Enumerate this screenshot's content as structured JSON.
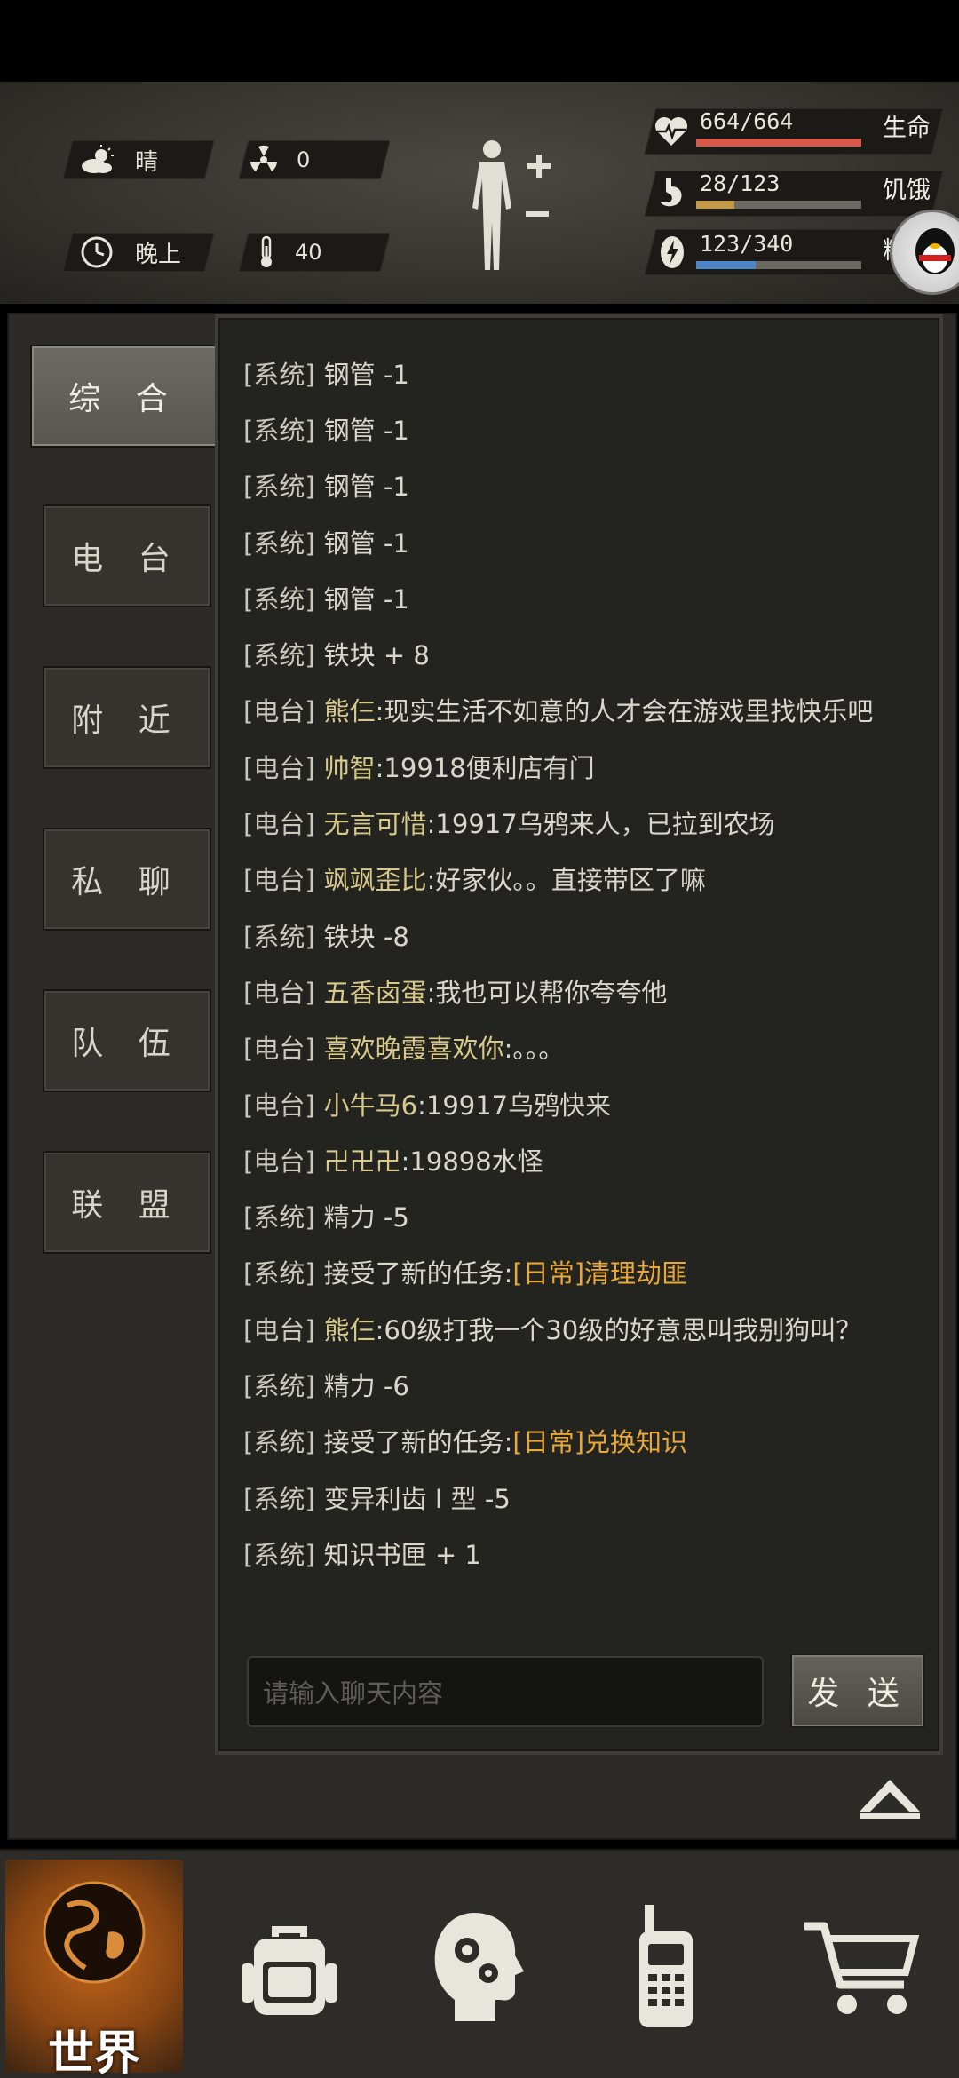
{
  "header": {
    "weather": "晴",
    "radiation": "0",
    "time_of_day": "晚上",
    "temperature": "40",
    "stats": [
      {
        "value": "664/664",
        "label": "生命",
        "fill": 1.0,
        "color": "#d65a4a"
      },
      {
        "value": "28/123",
        "label": "饥饿",
        "fill": 0.23,
        "color": "#c29a48"
      },
      {
        "value": "123/340",
        "label": "精力",
        "fill": 0.36,
        "color": "#4f86c6"
      }
    ]
  },
  "tabs": [
    "综 合",
    "电 台",
    "附 近",
    "私 聊",
    "队 伍",
    "联 盟"
  ],
  "chat": {
    "lines": [
      {
        "channel": "[系统]",
        "parts": [
          {
            "t": "钢管 -1",
            "c": "msg"
          }
        ]
      },
      {
        "channel": "[系统]",
        "parts": [
          {
            "t": "钢管 -1",
            "c": "msg"
          }
        ]
      },
      {
        "channel": "[系统]",
        "parts": [
          {
            "t": "钢管 -1",
            "c": "msg"
          }
        ]
      },
      {
        "channel": "[系统]",
        "parts": [
          {
            "t": "钢管 -1",
            "c": "msg"
          }
        ]
      },
      {
        "channel": "[系统]",
        "parts": [
          {
            "t": "钢管 -1",
            "c": "msg"
          }
        ]
      },
      {
        "channel": "[系统]",
        "parts": [
          {
            "t": "铁块 + 8",
            "c": "msg"
          }
        ]
      },
      {
        "channel": "[电台]",
        "parts": [
          {
            "t": "熊仨",
            "c": "nick"
          },
          {
            "t": ":现实生活不如意的人才会在游戏里找快乐吧",
            "c": "msg"
          }
        ]
      },
      {
        "channel": "[电台]",
        "parts": [
          {
            "t": "帅智",
            "c": "nick"
          },
          {
            "t": ":19918便利店有门",
            "c": "msg"
          }
        ]
      },
      {
        "channel": "[电台]",
        "parts": [
          {
            "t": "无言可惜",
            "c": "nick"
          },
          {
            "t": ":19917乌鸦来人，已拉到农场",
            "c": "msg"
          }
        ]
      },
      {
        "channel": "[电台]",
        "parts": [
          {
            "t": "飒飒歪比",
            "c": "nick"
          },
          {
            "t": ":好家伙。。直接带区了嘛",
            "c": "msg"
          }
        ]
      },
      {
        "channel": "[系统]",
        "parts": [
          {
            "t": "铁块 -8",
            "c": "msg"
          }
        ]
      },
      {
        "channel": "[电台]",
        "parts": [
          {
            "t": "五香卤蛋",
            "c": "nick"
          },
          {
            "t": ":我也可以帮你夸夸他",
            "c": "msg"
          }
        ]
      },
      {
        "channel": "[电台]",
        "parts": [
          {
            "t": "喜欢晚霞喜欢你",
            "c": "nick"
          },
          {
            "t": ":。。。",
            "c": "msg"
          }
        ]
      },
      {
        "channel": "[电台]",
        "parts": [
          {
            "t": "小牛马6",
            "c": "nick"
          },
          {
            "t": ":19917乌鸦快来",
            "c": "msg"
          }
        ]
      },
      {
        "channel": "[电台]",
        "parts": [
          {
            "t": "卍卍卍",
            "c": "nick"
          },
          {
            "t": ":19898水怪",
            "c": "msg"
          }
        ]
      },
      {
        "channel": "[系统]",
        "parts": [
          {
            "t": "精力 -5",
            "c": "msg"
          }
        ]
      },
      {
        "channel": "[系统]",
        "parts": [
          {
            "t": "接受了新的任务:",
            "c": "msg"
          },
          {
            "t": "[日常]清理劫匪",
            "c": "hl"
          }
        ]
      },
      {
        "channel": "[电台]",
        "parts": [
          {
            "t": "熊仨",
            "c": "nick"
          },
          {
            "t": ":60级打我一个30级的好意思叫我别狗叫？",
            "c": "msg"
          }
        ]
      },
      {
        "channel": "[系统]",
        "parts": [
          {
            "t": "精力 -6",
            "c": "msg"
          }
        ]
      },
      {
        "channel": "[系统]",
        "parts": [
          {
            "t": "接受了新的任务:",
            "c": "msg"
          },
          {
            "t": "[日常]兑换知识",
            "c": "hl"
          }
        ]
      },
      {
        "channel": "[系统]",
        "parts": [
          {
            "t": "变异利齿 Ⅰ 型 -5",
            "c": "msg"
          }
        ]
      },
      {
        "channel": "[系统]",
        "parts": [
          {
            "t": "知识书匣 + 1",
            "c": "msg"
          }
        ]
      }
    ],
    "input_placeholder": "请输入聊天内容",
    "send_label": "发 送"
  },
  "bottom_nav": {
    "world_label": "世界",
    "items": [
      "world-globe-icon",
      "backpack-icon",
      "skills-head-icon",
      "radio-icon",
      "shop-cart-icon"
    ]
  }
}
